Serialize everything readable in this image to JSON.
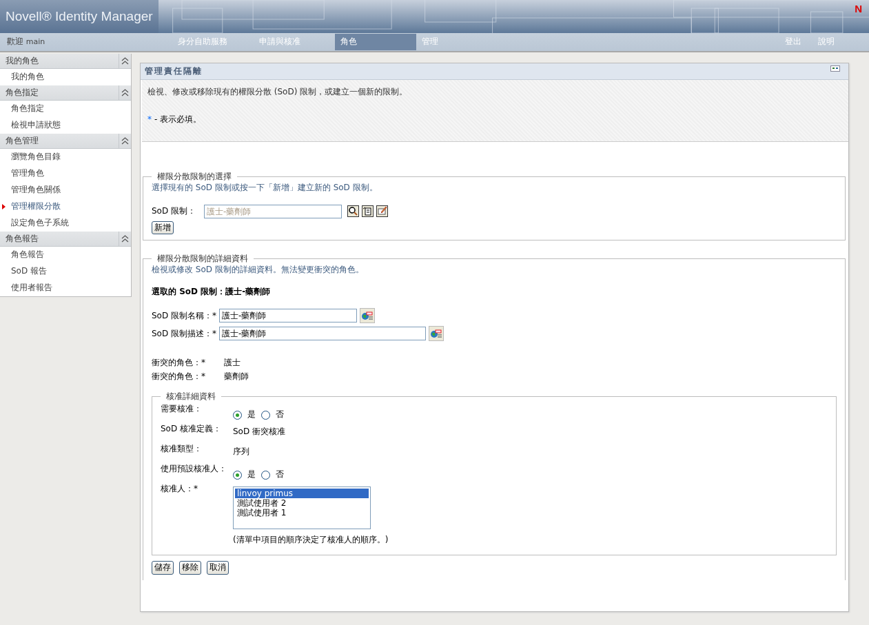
{
  "header": {
    "title": "Novell® Identity Manager",
    "logo": "N"
  },
  "nav": {
    "welcome": "歡迎",
    "user": "main",
    "tabs": [
      {
        "label": "身分自助服務",
        "selected": false
      },
      {
        "label": "申請與核准",
        "selected": false
      },
      {
        "label": "角色",
        "selected": true
      },
      {
        "label": "管理",
        "selected": false
      }
    ],
    "links": [
      "登出",
      "說明"
    ]
  },
  "sidebar": [
    {
      "title": "我的角色",
      "expanded": true,
      "items": [
        {
          "label": "我的角色",
          "selected": false
        }
      ]
    },
    {
      "title": "角色指定",
      "expanded": true,
      "items": [
        {
          "label": "角色指定",
          "selected": false
        },
        {
          "label": "檢視申請狀態",
          "selected": false
        }
      ]
    },
    {
      "title": "角色管理",
      "expanded": true,
      "items": [
        {
          "label": "瀏覽角色目錄",
          "selected": false
        },
        {
          "label": "管理角色",
          "selected": false
        },
        {
          "label": "管理角色關係",
          "selected": false
        },
        {
          "label": "管理權限分散",
          "selected": true
        },
        {
          "label": "設定角色子系統",
          "selected": false
        }
      ]
    },
    {
      "title": "角色報告",
      "expanded": true,
      "items": [
        {
          "label": "角色報告",
          "selected": false
        },
        {
          "label": "SoD 報告",
          "selected": false
        },
        {
          "label": "使用者報告",
          "selected": false
        }
      ]
    }
  ],
  "panel": {
    "title": "管理責任隔離",
    "intro": "檢視、修改或移除現有的權限分散 (SoD) 限制，或建立一個新的限制。",
    "required_mark": "*",
    "required_note": "- 表示必填。",
    "selection": {
      "legend": "權限分散限制的選擇",
      "hint": "選擇現有的 SoD 限制或按一下「新增」建立新的 SoD 限制。",
      "label": "SoD 限制：",
      "placeholder": "護士-藥劑師",
      "button": "新增"
    },
    "details": {
      "legend": "權限分散限制的詳細資料",
      "hint": "檢視或修改 SoD 限制的詳細資料。無法變更衝突的角色。",
      "heading": "選取的 SoD 限制：護士-藥劑師",
      "fields": [
        {
          "label": "SoD 限制名稱：*",
          "value": "護士-藥劑師"
        },
        {
          "label": "SoD 限制描述：*",
          "value": "護士-藥劑師"
        }
      ],
      "conflicts": [
        {
          "label": "衝突的角色：*",
          "value": "護士"
        },
        {
          "label": "衝突的角色：*",
          "value": "藥劑師"
        }
      ],
      "approval": {
        "legend": "核准詳細資料",
        "rows": [
          {
            "kind": "radio",
            "label": "需要核准：",
            "options": [
              {
                "label": "是",
                "selected": true
              },
              {
                "label": "否",
                "selected": false
              }
            ]
          },
          {
            "kind": "text",
            "label": "SoD 核准定義：",
            "value": "SoD 衝突核准"
          },
          {
            "kind": "text",
            "label": "核准類型：",
            "value": "序列"
          },
          {
            "kind": "radio",
            "label": "使用預設核准人：",
            "options": [
              {
                "label": "是",
                "selected": true
              },
              {
                "label": "否",
                "selected": false
              }
            ]
          },
          {
            "kind": "list",
            "label": "核准人：*",
            "items": [
              {
                "label": "linvoy primus",
                "selected": true
              },
              {
                "label": "測試使用者 2",
                "selected": false
              },
              {
                "label": "測試使用者 1",
                "selected": false
              }
            ],
            "note": "(清單中項目的順序決定了核准人的順序。)"
          }
        ]
      }
    },
    "buttons": [
      "儲存",
      "移除",
      "取消"
    ]
  }
}
